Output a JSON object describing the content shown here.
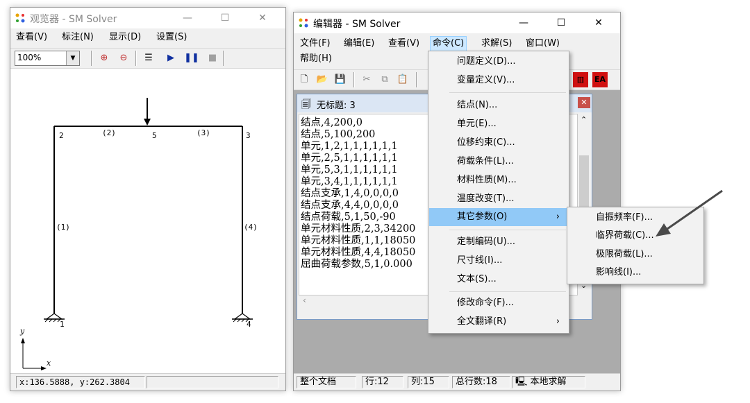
{
  "viewer": {
    "title": "观览器 - SM Solver",
    "menu": [
      "查看(V)",
      "标注(N)",
      "显示(D)",
      "设置(S)"
    ],
    "zoom": "100%",
    "nodes": [
      "1",
      "2",
      "3",
      "4",
      "5"
    ],
    "elements": [
      "(1)",
      "(2)",
      "(3)",
      "(4)"
    ],
    "axis": {
      "x": "x",
      "y": "y"
    },
    "status_coords": "x:136.5888, y:262.3804"
  },
  "editor": {
    "title": "编辑器 - SM Solver",
    "menu": [
      "文件(F)",
      "编辑(E)",
      "查看(V)",
      "命令(C)",
      "求解(S)",
      "窗口(W)"
    ],
    "menu2": [
      "帮助(H)"
    ],
    "doc_title": "无标题: 3",
    "lines": [
      "结点,4,200,0",
      "结点,5,100,200",
      "单元,1,2,1,1,1,1,1,1",
      "单元,2,5,1,1,1,1,1,1",
      "单元,5,3,1,1,1,1,1,1",
      "单元,3,4,1,1,1,1,1,1",
      "结点支承,1,4,0,0,0,0",
      "结点支承,4,4,0,0,0,0",
      "结点荷载,5,1,50,-90",
      "单元材料性质,2,3,34200",
      "单元材料性质,1,1,18050",
      "单元材料性质,4,4,18050",
      "屈曲荷载参数,5,1,0.000"
    ],
    "status": {
      "scope": "整个文档",
      "row": "行:12",
      "col": "列:15",
      "total": "总行数:18",
      "mode": "本地求解"
    },
    "toolbar_right": "EA"
  },
  "command_menu": {
    "items": [
      {
        "label": "问题定义(D)..."
      },
      {
        "label": "变量定义(V)..."
      },
      {
        "label": "结点(N)..."
      },
      {
        "label": "单元(E)..."
      },
      {
        "label": "位移约束(C)..."
      },
      {
        "label": "荷载条件(L)..."
      },
      {
        "label": "材料性质(M)..."
      },
      {
        "label": "温度改变(T)..."
      },
      {
        "label": "其它参数(O)",
        "arrow": "›"
      },
      {
        "label": "定制编码(U)..."
      },
      {
        "label": "尺寸线(I)..."
      },
      {
        "label": "文本(S)..."
      },
      {
        "label": "修改命令(F)..."
      },
      {
        "label": "全文翻译(R)",
        "arrow": "›"
      }
    ]
  },
  "submenu": {
    "items": [
      "自振频率(F)...",
      "临界荷载(C)...",
      "极限荷载(L)...",
      "影响线(I)..."
    ]
  },
  "colors": {
    "menu_highlight": "#91c9f7",
    "pointer_arrow": "#4a4a4a",
    "accent_red": "#d01010"
  }
}
